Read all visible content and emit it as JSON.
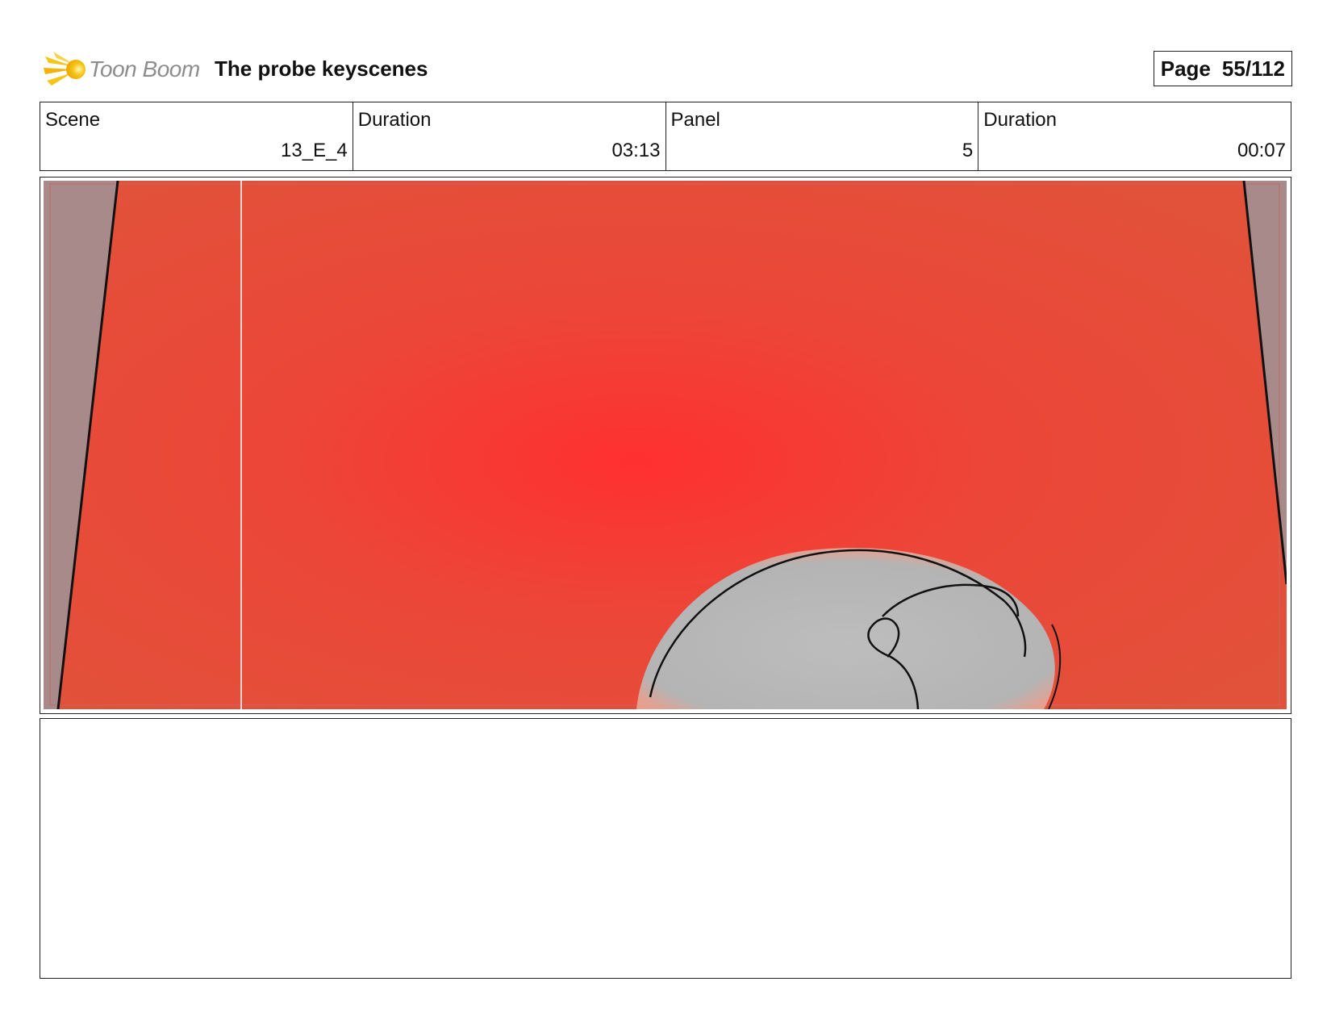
{
  "header": {
    "logo_text": "Toon Boom",
    "title": "The probe keyscenes",
    "page_label": "Page",
    "page_number": "55/112"
  },
  "info": {
    "scene_label": "Scene",
    "scene_value": "13_E_4",
    "scene_duration_label": "Duration",
    "scene_duration_value": "03:13",
    "panel_label": "Panel",
    "panel_value": "5",
    "panel_duration_label": "Duration",
    "panel_duration_value": "00:07"
  },
  "colors": {
    "background_red": "#e84a3a",
    "glow_center": "#ff3030",
    "side_gray": "#a88a8a",
    "figure_gray": "#b8b8b8",
    "logo_yellow": "#f5c518"
  },
  "icons": {
    "logo": "toon-boom-comet-logo"
  }
}
